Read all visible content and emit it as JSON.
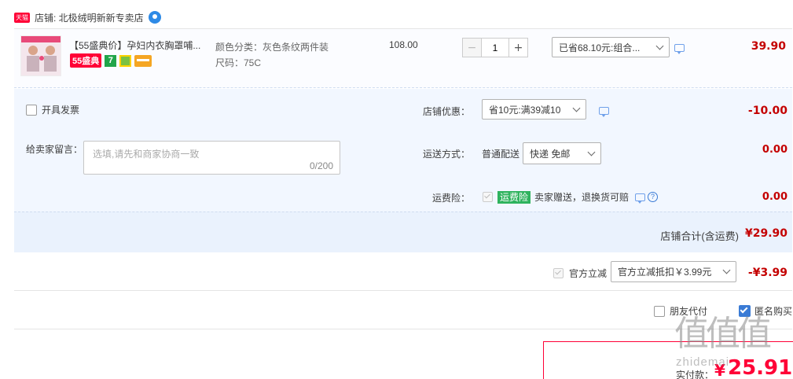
{
  "shop": {
    "badge": "天猫",
    "name": "店铺: 北极绒明新新专卖店"
  },
  "item": {
    "title": "【55盛典价】孕妇内衣胸罩哺...",
    "promo_tag": "55盛典",
    "attr_color": "颜色分类：灰色条纹两件装",
    "attr_size": "尺码：75C",
    "unit_price": "108.00",
    "quantity": "1",
    "minus": "−",
    "plus": "+",
    "discount_select": "已省68.10元:组合...",
    "subtotal": "39.90"
  },
  "invoice": {
    "label": "开具发票"
  },
  "message": {
    "label": "给卖家留言：",
    "placeholder": "选填,请先和商家协商一致",
    "counter": "0/200"
  },
  "shop_discount": {
    "label": "店铺优惠：",
    "select": "省10元:满39减10",
    "amount": "-10.00"
  },
  "shipping": {
    "label": "运送方式：",
    "method": "普通配送",
    "select": "快递 免邮",
    "amount": "0.00"
  },
  "insurance": {
    "label": "运费险：",
    "tag": "运费险",
    "desc": "卖家赠送，退换货可赔",
    "amount": "0.00"
  },
  "shop_total": {
    "label": "店铺合计(含运费)",
    "amount": "¥29.90"
  },
  "official": {
    "label": "官方立减",
    "select": "官方立减抵扣￥3.99元",
    "amount": "-¥3.99"
  },
  "options": {
    "friend_pay": "朋友代付",
    "anonymous": "匿名购买"
  },
  "payment": {
    "label": "实付款：",
    "currency": "¥",
    "amount": "25.91"
  },
  "watermark": {
    "text": "值值值",
    "sub": "zhidemai"
  },
  "colors": {
    "accent": "#ff0036",
    "price": "#c40000",
    "panel": "#f2f7ff",
    "link": "#3a7bd5"
  }
}
